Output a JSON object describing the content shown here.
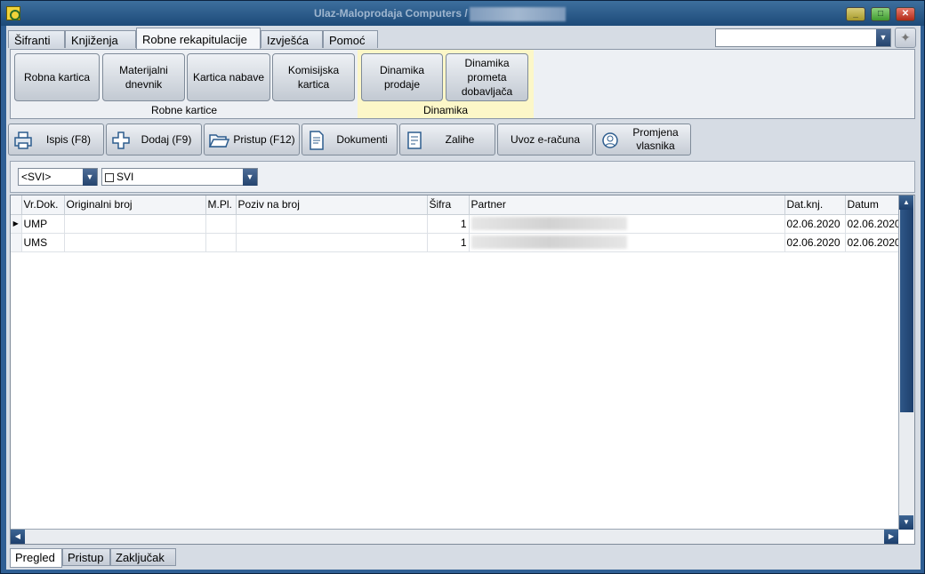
{
  "window": {
    "title": "Ulaz-Maloprodaja Computers /"
  },
  "tabs": [
    {
      "label": "Šifranti"
    },
    {
      "label": "Knjiženja"
    },
    {
      "label": "Robne rekapitulacije"
    },
    {
      "label": "Izvješća"
    },
    {
      "label": "Pomoć"
    }
  ],
  "ribbon": {
    "kartice": {
      "label": "Robne kartice",
      "buttons": [
        "Robna kartica",
        "Materijalni dnevnik",
        "Kartica nabave",
        "Komisijska kartica"
      ]
    },
    "dinamika": {
      "label": "Dinamika",
      "buttons": [
        "Dinamika prodaje",
        "Dinamika prometa dobavljača"
      ]
    }
  },
  "toolbar": {
    "ispis": "Ispis (F8)",
    "dodaj": "Dodaj (F9)",
    "pristup": "Pristup (F12)",
    "dokumenti": "Dokumenti",
    "zalihe": "Zalihe",
    "uvoz": "Uvoz e-računa",
    "promjena": "Promjena vlasnika"
  },
  "filters": {
    "first": "<SVI>",
    "second": "SVI"
  },
  "grid": {
    "columns": [
      "Vr.Dok.",
      "Originalni broj",
      "M.Pl.",
      "Poziv na broj",
      "Šifra",
      "Partner",
      "Dat.knj.",
      "Datum"
    ],
    "rows": [
      {
        "vrdok": "UMP",
        "sifra": "1",
        "datknj": "02.06.2020",
        "datum": "02.06.2020"
      },
      {
        "vrdok": "UMS",
        "sifra": "1",
        "datknj": "02.06.2020",
        "datum": "02.06.2020"
      }
    ]
  },
  "bottom_tabs": [
    {
      "label": "Pregled"
    },
    {
      "label": "Pristup"
    },
    {
      "label": "Zaključak"
    }
  ]
}
